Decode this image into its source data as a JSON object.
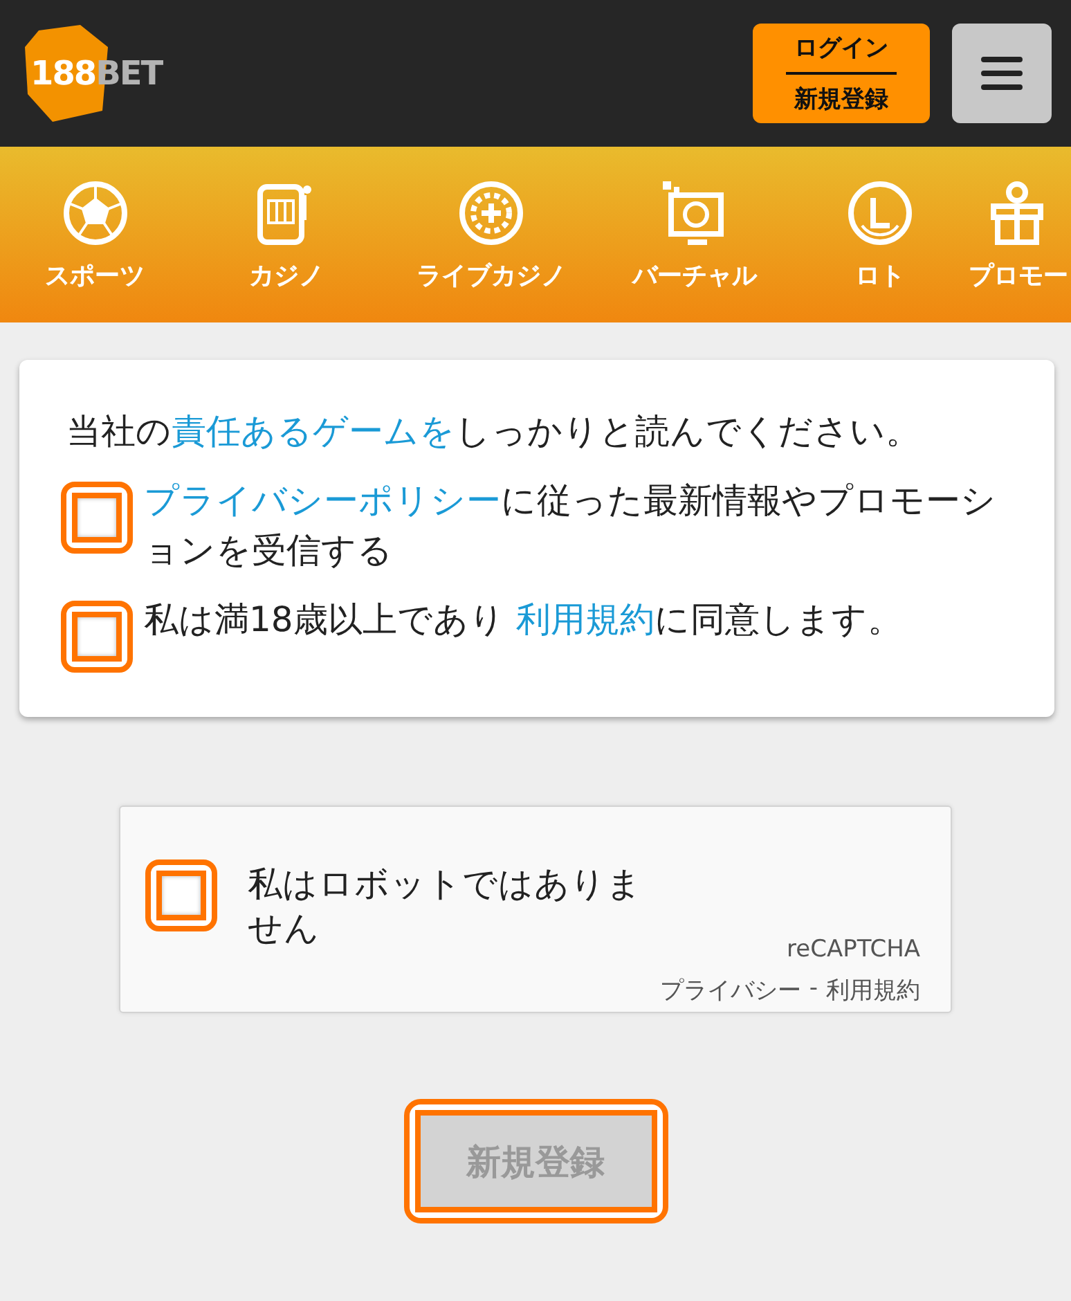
{
  "header": {
    "logo": {
      "number": "188",
      "word": "BET"
    },
    "login_button": {
      "top": "ログイン",
      "bottom": "新規登録"
    }
  },
  "nav": [
    {
      "kind": "sports",
      "label": "スポーツ"
    },
    {
      "kind": "casino",
      "label": "カジノ"
    },
    {
      "kind": "live",
      "label": "ライブカジノ"
    },
    {
      "kind": "virtual",
      "label": "バーチャル"
    },
    {
      "kind": "lotto",
      "label": "ロト"
    },
    {
      "kind": "promo",
      "label": "プロモー"
    }
  ],
  "consent": {
    "intro": [
      {
        "text": "当社の",
        "link": false
      },
      {
        "text": "責任あるゲームを",
        "link": true
      },
      {
        "text": "しっかりと読んでください。",
        "link": false
      }
    ],
    "checkboxes": [
      {
        "checked": false,
        "parts": [
          {
            "text": "プライバシーポリシー",
            "link": true
          },
          {
            "text": "に従った最新情報やプロモーションを受信する",
            "link": false
          }
        ]
      },
      {
        "checked": false,
        "parts": [
          {
            "text": "私は満18歳以上であり ",
            "link": false
          },
          {
            "text": "利用規約",
            "link": true
          },
          {
            "text": "に同意します。",
            "link": false
          }
        ]
      }
    ]
  },
  "captcha": {
    "checked": false,
    "label": "私はロボットではありません",
    "brand": "reCAPTCHA",
    "privacy": "プライバシー",
    "separator": "-",
    "terms": "利用規約"
  },
  "submit": {
    "label": "新規登録",
    "disabled": true
  }
}
